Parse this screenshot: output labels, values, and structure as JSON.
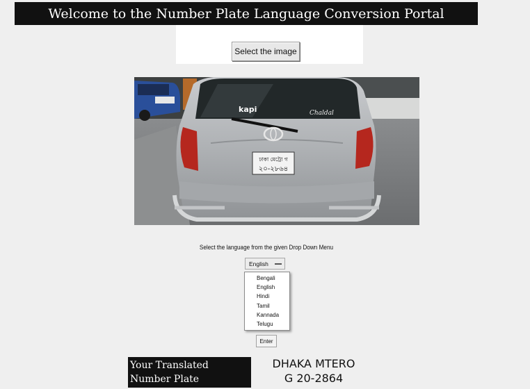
{
  "header": {
    "title": "Welcome to the Number Plate Language Conversion Portal"
  },
  "upload": {
    "button_label": "Select the image"
  },
  "image": {
    "plate_line1": "ঢাকা মেট্রো গ",
    "plate_line2": "২০-২৮৬৪",
    "sticker_kapi": "kapi",
    "sticker_chaldal": "Chaldal"
  },
  "language": {
    "prompt": "Select the language from the given Drop Down Menu",
    "selected": "English",
    "options": [
      "Bengali",
      "English",
      "Hindi",
      "Tamil",
      "Kannada",
      "Telugu"
    ]
  },
  "actions": {
    "enter_label": "Enter"
  },
  "result": {
    "label_line1": "Your Translated",
    "label_line2": "Number Plate",
    "value_line1": "DHAKA MTERO",
    "value_line2": "G 20-2864"
  }
}
